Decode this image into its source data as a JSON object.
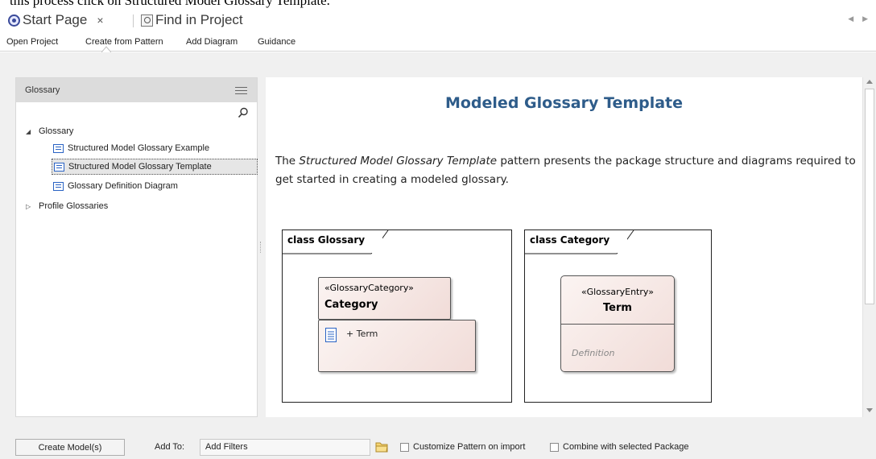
{
  "doc_clip_text": "this process click on Structured Model Glossary Template.",
  "tabs": [
    {
      "label": "Start Page",
      "close": "×"
    },
    {
      "label": "Find in Project"
    }
  ],
  "subnav": [
    "Open Project",
    "Create from Pattern",
    "Add Diagram",
    "Guidance"
  ],
  "left_panel": {
    "title": "Glossary",
    "tree": [
      {
        "label": "Glossary",
        "expander": "◢"
      },
      {
        "label": "Structured Model Glossary Example"
      },
      {
        "label": "Structured Model Glossary Template",
        "selected": true
      },
      {
        "label": "Glossary Definition Diagram"
      },
      {
        "label": "Profile Glossaries",
        "expander": "▷"
      }
    ]
  },
  "main": {
    "title": "Modeled Glossary Template",
    "desc_prefix": "The ",
    "desc_em": "Structured Model Glossary Template",
    "desc_suffix": " pattern presents the package structure and diagrams required to get started in creating a modeled glossary.",
    "diagrams": [
      {
        "frame_label": "class Glossary",
        "stereotype": "«GlossaryCategory»",
        "name": "Category",
        "attribute": "+ Term"
      },
      {
        "frame_label": "class Category",
        "stereotype": "«GlossaryEntry»",
        "name": "Term",
        "note": "Definition"
      }
    ]
  },
  "bottom": {
    "create_button": "Create Model(s)",
    "add_to_label": "Add To:",
    "add_to_value": "Add Filters",
    "checkbox1": "Customize Pattern on import",
    "checkbox2": "Combine with selected Package"
  }
}
